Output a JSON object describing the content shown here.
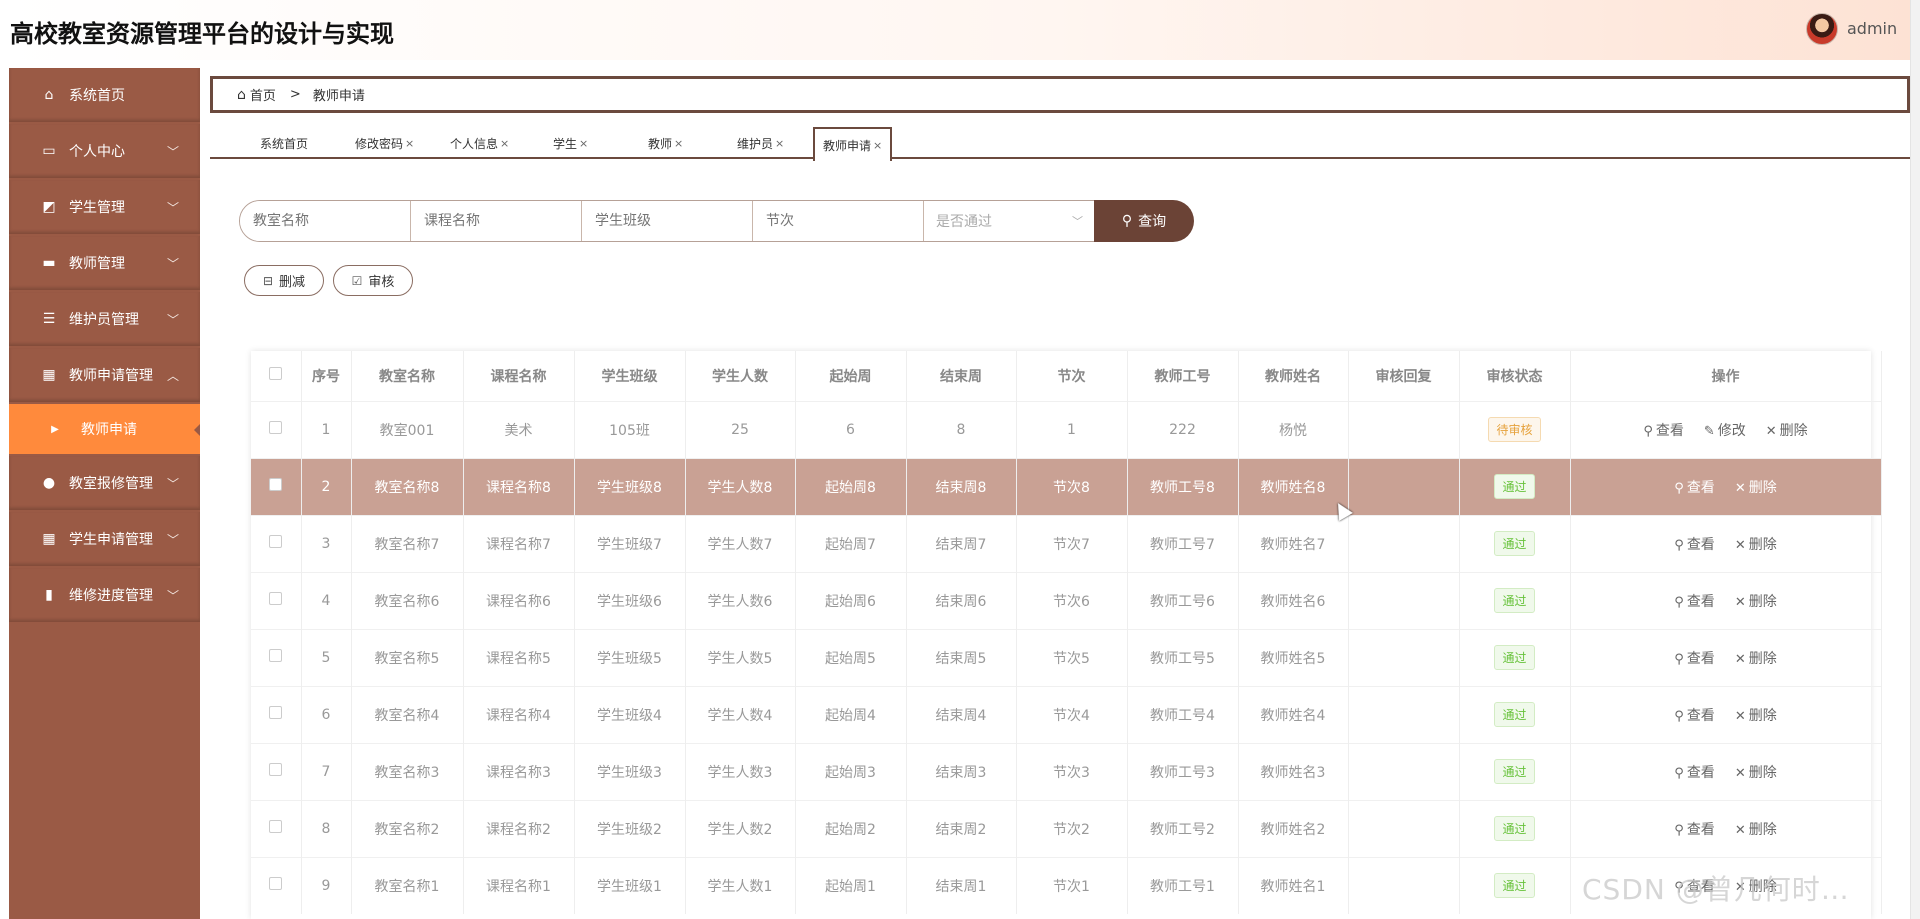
{
  "app": {
    "title": "高校教室资源管理平台的设计与实现",
    "user": "admin"
  },
  "sidebar": {
    "items": [
      {
        "label": "系统首页",
        "icon": "home-icon",
        "arrow": ""
      },
      {
        "label": "个人中心",
        "icon": "card-icon",
        "arrow": "﹀"
      },
      {
        "label": "学生管理",
        "icon": "chart-icon",
        "arrow": "﹀"
      },
      {
        "label": "教师管理",
        "icon": "monitor-icon",
        "arrow": "﹀"
      },
      {
        "label": "维护员管理",
        "icon": "list-icon",
        "arrow": "﹀"
      },
      {
        "label": "教师申请管理",
        "icon": "grid-icon",
        "arrow": "︿"
      },
      {
        "label": "教师申请",
        "icon": "caret-right-icon",
        "arrow": ""
      },
      {
        "label": "教室报修管理",
        "icon": "user-icon",
        "arrow": "﹀"
      },
      {
        "label": "学生申请管理",
        "icon": "grid-icon",
        "arrow": "﹀"
      },
      {
        "label": "维修进度管理",
        "icon": "bar-chart-icon",
        "arrow": "﹀"
      }
    ]
  },
  "breadcrumb": {
    "home": "首页",
    "separator": ">",
    "current": "教师申请"
  },
  "tabs": [
    {
      "label": "系统首页",
      "close": ""
    },
    {
      "label": "修改密码",
      "close": "×"
    },
    {
      "label": "个人信息",
      "close": "×"
    },
    {
      "label": "学生",
      "close": "×"
    },
    {
      "label": "教师",
      "close": "×"
    },
    {
      "label": "维护员",
      "close": "×"
    },
    {
      "label": "教师申请",
      "close": "×"
    }
  ],
  "search": {
    "classroom_placeholder": "教室名称",
    "course_placeholder": "课程名称",
    "class_placeholder": "学生班级",
    "section_placeholder": "节次",
    "passed_placeholder": "是否通过",
    "query_label": "查询"
  },
  "actions": {
    "delete_label": "删减",
    "audit_label": "审核"
  },
  "table": {
    "headers": [
      "序号",
      "教室名称",
      "课程名称",
      "学生班级",
      "学生人数",
      "起始周",
      "结束周",
      "节次",
      "教师工号",
      "教师姓名",
      "审核回复",
      "审核状态",
      "操作"
    ],
    "rows": [
      {
        "no": "1",
        "classroom": "教室001",
        "course": "美术",
        "class": "105班",
        "count": "25",
        "start": "6",
        "end": "8",
        "section": "1",
        "teacher_id": "222",
        "teacher_name": "杨悦",
        "reply": "",
        "status": "待审核",
        "status_type": "pending",
        "ops": [
          "查看",
          "修改",
          "删除"
        ]
      },
      {
        "no": "2",
        "classroom": "教室名称8",
        "course": "课程名称8",
        "class": "学生班级8",
        "count": "学生人数8",
        "start": "起始周8",
        "end": "结束周8",
        "section": "节次8",
        "teacher_id": "教师工号8",
        "teacher_name": "教师姓名8",
        "reply": "",
        "status": "通过",
        "status_type": "pass",
        "ops": [
          "查看",
          "删除"
        ]
      },
      {
        "no": "3",
        "classroom": "教室名称7",
        "course": "课程名称7",
        "class": "学生班级7",
        "count": "学生人数7",
        "start": "起始周7",
        "end": "结束周7",
        "section": "节次7",
        "teacher_id": "教师工号7",
        "teacher_name": "教师姓名7",
        "reply": "",
        "status": "通过",
        "status_type": "pass",
        "ops": [
          "查看",
          "删除"
        ]
      },
      {
        "no": "4",
        "classroom": "教室名称6",
        "course": "课程名称6",
        "class": "学生班级6",
        "count": "学生人数6",
        "start": "起始周6",
        "end": "结束周6",
        "section": "节次6",
        "teacher_id": "教师工号6",
        "teacher_name": "教师姓名6",
        "reply": "",
        "status": "通过",
        "status_type": "pass",
        "ops": [
          "查看",
          "删除"
        ]
      },
      {
        "no": "5",
        "classroom": "教室名称5",
        "course": "课程名称5",
        "class": "学生班级5",
        "count": "学生人数5",
        "start": "起始周5",
        "end": "结束周5",
        "section": "节次5",
        "teacher_id": "教师工号5",
        "teacher_name": "教师姓名5",
        "reply": "",
        "status": "通过",
        "status_type": "pass",
        "ops": [
          "查看",
          "删除"
        ]
      },
      {
        "no": "6",
        "classroom": "教室名称4",
        "course": "课程名称4",
        "class": "学生班级4",
        "count": "学生人数4",
        "start": "起始周4",
        "end": "结束周4",
        "section": "节次4",
        "teacher_id": "教师工号4",
        "teacher_name": "教师姓名4",
        "reply": "",
        "status": "通过",
        "status_type": "pass",
        "ops": [
          "查看",
          "删除"
        ]
      },
      {
        "no": "7",
        "classroom": "教室名称3",
        "course": "课程名称3",
        "class": "学生班级3",
        "count": "学生人数3",
        "start": "起始周3",
        "end": "结束周3",
        "section": "节次3",
        "teacher_id": "教师工号3",
        "teacher_name": "教师姓名3",
        "reply": "",
        "status": "通过",
        "status_type": "pass",
        "ops": [
          "查看",
          "删除"
        ]
      },
      {
        "no": "8",
        "classroom": "教室名称2",
        "course": "课程名称2",
        "class": "学生班级2",
        "count": "学生人数2",
        "start": "起始周2",
        "end": "结束周2",
        "section": "节次2",
        "teacher_id": "教师工号2",
        "teacher_name": "教师姓名2",
        "reply": "",
        "status": "通过",
        "status_type": "pass",
        "ops": [
          "查看",
          "删除"
        ]
      },
      {
        "no": "9",
        "classroom": "教室名称1",
        "course": "课程名称1",
        "class": "学生班级1",
        "count": "学生人数1",
        "start": "起始周1",
        "end": "结束周1",
        "section": "节次1",
        "teacher_id": "教师工号1",
        "teacher_name": "教师姓名1",
        "reply": "",
        "status": "通过",
        "status_type": "pass",
        "ops": [
          "查看",
          "删除"
        ]
      }
    ]
  },
  "watermark": "CSDN @曾几何时…",
  "colors": {
    "sidebar": "#9a5a45",
    "active": "#ff8a3c",
    "primary": "#6b4336",
    "highlight_row": "#c9a194"
  }
}
